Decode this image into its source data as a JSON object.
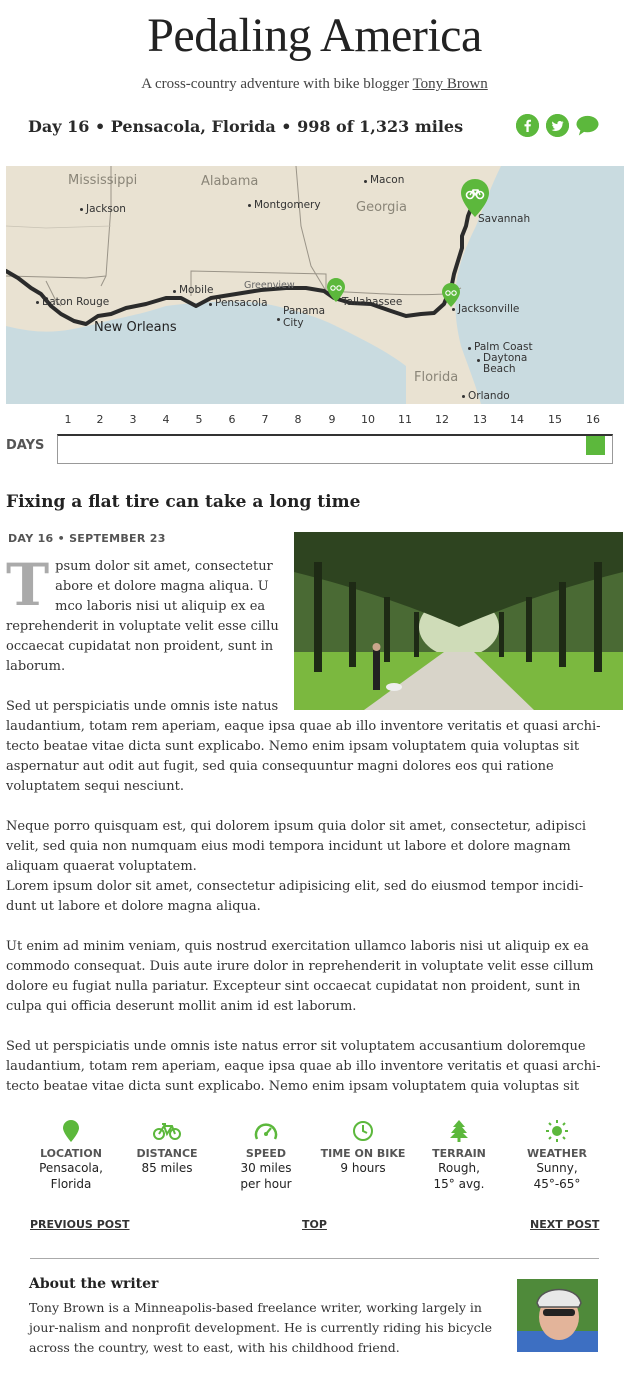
{
  "header": {
    "title": "Pedaling America",
    "tagline_prefix": "A cross-country adventure with bike blogger",
    "author_link": "Tony Brown",
    "dayline": "Day 16 • Pensacola, Florida • 998 of 1,323 miles"
  },
  "social": {
    "facebook_icon": "f",
    "twitter_icon": "t",
    "comment_icon": "c"
  },
  "map": {
    "states": [
      "Mississippi",
      "Alabama",
      "Georgia",
      "Florida"
    ],
    "cities": [
      "Macon",
      "Savannah",
      "Jackson",
      "Montgomery",
      "Mobile",
      "Greenview",
      "Pensacola",
      "Tallahassee",
      "Jacksonville",
      "Panama City",
      "Baton Rouge",
      "New Orleans",
      "Palm Coast",
      "Daytona Beach",
      "Orlando"
    ]
  },
  "timeline": {
    "label": "DAYS",
    "days": [
      "1",
      "2",
      "3",
      "4",
      "5",
      "6",
      "7",
      "8",
      "9",
      "10",
      "11",
      "12",
      "13",
      "14",
      "15",
      "16"
    ],
    "current_day": 16
  },
  "post": {
    "title": "Fixing a flat tire can take a long time",
    "date": "DAY 16 • SEPTEMBER 23",
    "dropcap": "T",
    "p1_lines": [
      "psum dolor sit amet, consectetur",
      "abore et dolore magna aliqua. U",
      "mco laboris nisi ut aliquip ex ea",
      "reprehenderit in voluptate velit esse cillu",
      "occaecat cupidatat non proident, sunt in",
      "laborum."
    ],
    "p2_first": "Sed ut perspiciatis unde omnis iste natus",
    "p2_rest": "laudantium, totam rem aperiam, eaque ipsa quae ab illo inventore veritatis et quasi archi-tecto beatae vitae dicta sunt explicabo. Nemo enim ipsam voluptatem quia voluptas sit aspernatur aut odit aut fugit, sed quia consequuntur magni dolores eos qui ratione voluptatem sequi nesciunt.",
    "p3": "Neque porro quisquam est, qui dolorem ipsum quia dolor sit amet, consectetur, adipisci velit, sed quia non numquam eius modi tempora incidunt ut labore et dolore magnam aliquam quaerat voluptatem.",
    "p3b": "Lorem ipsum dolor sit amet, consectetur adipisicing elit, sed do eiusmod tempor incidi-dunt ut labore et dolore magna aliqua.",
    "p4": "Ut enim ad minim veniam, quis nostrud exercitation ullamco laboris nisi ut aliquip ex ea commodo consequat. Duis aute irure dolor in reprehenderit in voluptate velit esse cillum dolore eu fugiat nulla pariatur. Excepteur sint occaecat cupidatat non proident, sunt in culpa qui officia deserunt mollit anim id est laborum.",
    "p5": "Sed ut perspiciatis unde omnis iste natus error sit voluptatem accusantium doloremque laudantium, totam rem aperiam, eaque ipsa quae ab illo inventore veritatis et quasi archi-tecto beatae vitae dicta sunt explicabo. Nemo enim ipsam voluptatem quia voluptas sit"
  },
  "stats": [
    {
      "icon": "location-pin-icon",
      "label": "LOCATION",
      "value": "Pensacola,\nFlorida"
    },
    {
      "icon": "bicycle-icon",
      "label": "DISTANCE",
      "value": "85 miles"
    },
    {
      "icon": "speedometer-icon",
      "label": "SPEED",
      "value": "30 miles\nper hour"
    },
    {
      "icon": "clock-icon",
      "label": "TIME ON BIKE",
      "value": "9 hours"
    },
    {
      "icon": "tree-icon",
      "label": "TERRAIN",
      "value": "Rough,\n15° avg."
    },
    {
      "icon": "sun-icon",
      "label": "WEATHER",
      "value": "Sunny,\n45°-65°"
    }
  ],
  "nav": {
    "previous": "PREVIOUS POST",
    "top": "TOP",
    "next": "NEXT POST"
  },
  "about": {
    "title": "About the writer",
    "text": "Tony Brown is a Minneapolis-based freelance writer, working largely in jour-nalism and nonprofit development. He is currently riding his bicycle across the country, west to east, with his childhood friend."
  },
  "colors": {
    "accent": "#5cb83c",
    "route": "#2b2b2b",
    "water": "#c9dbe0",
    "land": "#e9e2d2"
  }
}
